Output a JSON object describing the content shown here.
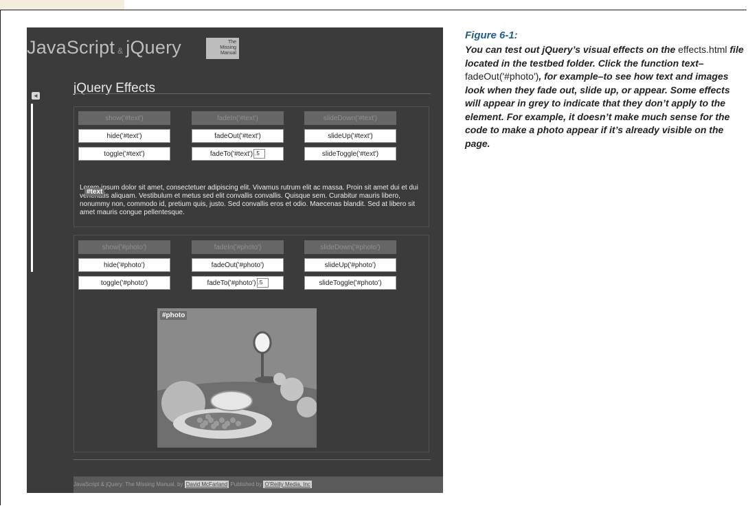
{
  "screenshot": {
    "site_title_part1": "JavaScript",
    "site_title_amp": "&",
    "site_title_part2": "jQuery",
    "logo_line1": "The",
    "logo_line2": "Missing",
    "logo_line3": "Manual",
    "page_heading": "jQuery Effects",
    "text_buttons": [
      {
        "label": "show('#text')",
        "disabled": true
      },
      {
        "label": "fadeIn('#text')",
        "disabled": true
      },
      {
        "label": "slideDown('#text')",
        "disabled": true
      },
      {
        "label": "hide('#text')",
        "disabled": false
      },
      {
        "label": "fadeOut('#text')",
        "disabled": false
      },
      {
        "label": "slideUp('#text')",
        "disabled": false
      },
      {
        "label": "toggle('#text')",
        "disabled": false
      },
      {
        "label": "fadeTo('#text')",
        "disabled": false,
        "input_value": ".5"
      },
      {
        "label": "slideToggle('#text')",
        "disabled": false
      }
    ],
    "text_tag": "#text",
    "lorem": "Lorem ipsum dolor sit amet, consectetuer adipiscing elit. Vivamus rutrum elit ac massa. Proin sit amet dui et dui venenatis aliquam. Vestibulum et metus sed elit convallis convallis. Quisque sem. Curabitur mauris libero, nonummy non, commodo id, pretium quis, justo. Sed convallis eros et odio. Maecenas blandit. Sed at libero sit amet mauris congue pellentesque.",
    "photo_buttons": [
      {
        "label": "show('#photo')",
        "disabled": true
      },
      {
        "label": "fadeIn('#photo')",
        "disabled": true
      },
      {
        "label": "slideDown('#photo')",
        "disabled": true
      },
      {
        "label": "hide('#photo')",
        "disabled": false
      },
      {
        "label": "fadeOut('#photo')",
        "disabled": false
      },
      {
        "label": "slideUp('#photo')",
        "disabled": false
      },
      {
        "label": "toggle('#photo')",
        "disabled": false
      },
      {
        "label": "fadeTo('#photo')",
        "disabled": false,
        "input_value": ".5"
      },
      {
        "label": "slideToggle('#photo')",
        "disabled": false
      }
    ],
    "photo_tag": "#photo",
    "footer_prefix": "JavaScript & jQuery: The Missing Manual, by",
    "footer_author": "David McFarland",
    "footer_mid": "Published by",
    "footer_publisher": "O'Reilly Media, Inc"
  },
  "caption": {
    "title": "Figure 6-1:",
    "segments": [
      {
        "text": "You can test out jQuery’s visual effects on the ",
        "code": false
      },
      {
        "text": "effects.html",
        "code": true
      },
      {
        "text": " file located in the testbed folder. Click the function text–",
        "code": false
      },
      {
        "text": "fadeOut('#photo')",
        "code": true
      },
      {
        "text": ", for example–to see how text and images look when they fade out, slide up, or appear. Some effects will appear in grey to indicate that they don’t apply to the element. For example, it doesn’t make much sense for the code to make a photo appear if it’s already visible on the page.",
        "code": false
      }
    ]
  },
  "colors": {
    "caption_title": "#1f5d8c",
    "page_background": "#3b3b3b",
    "corner_tab": "#f4eddc"
  }
}
